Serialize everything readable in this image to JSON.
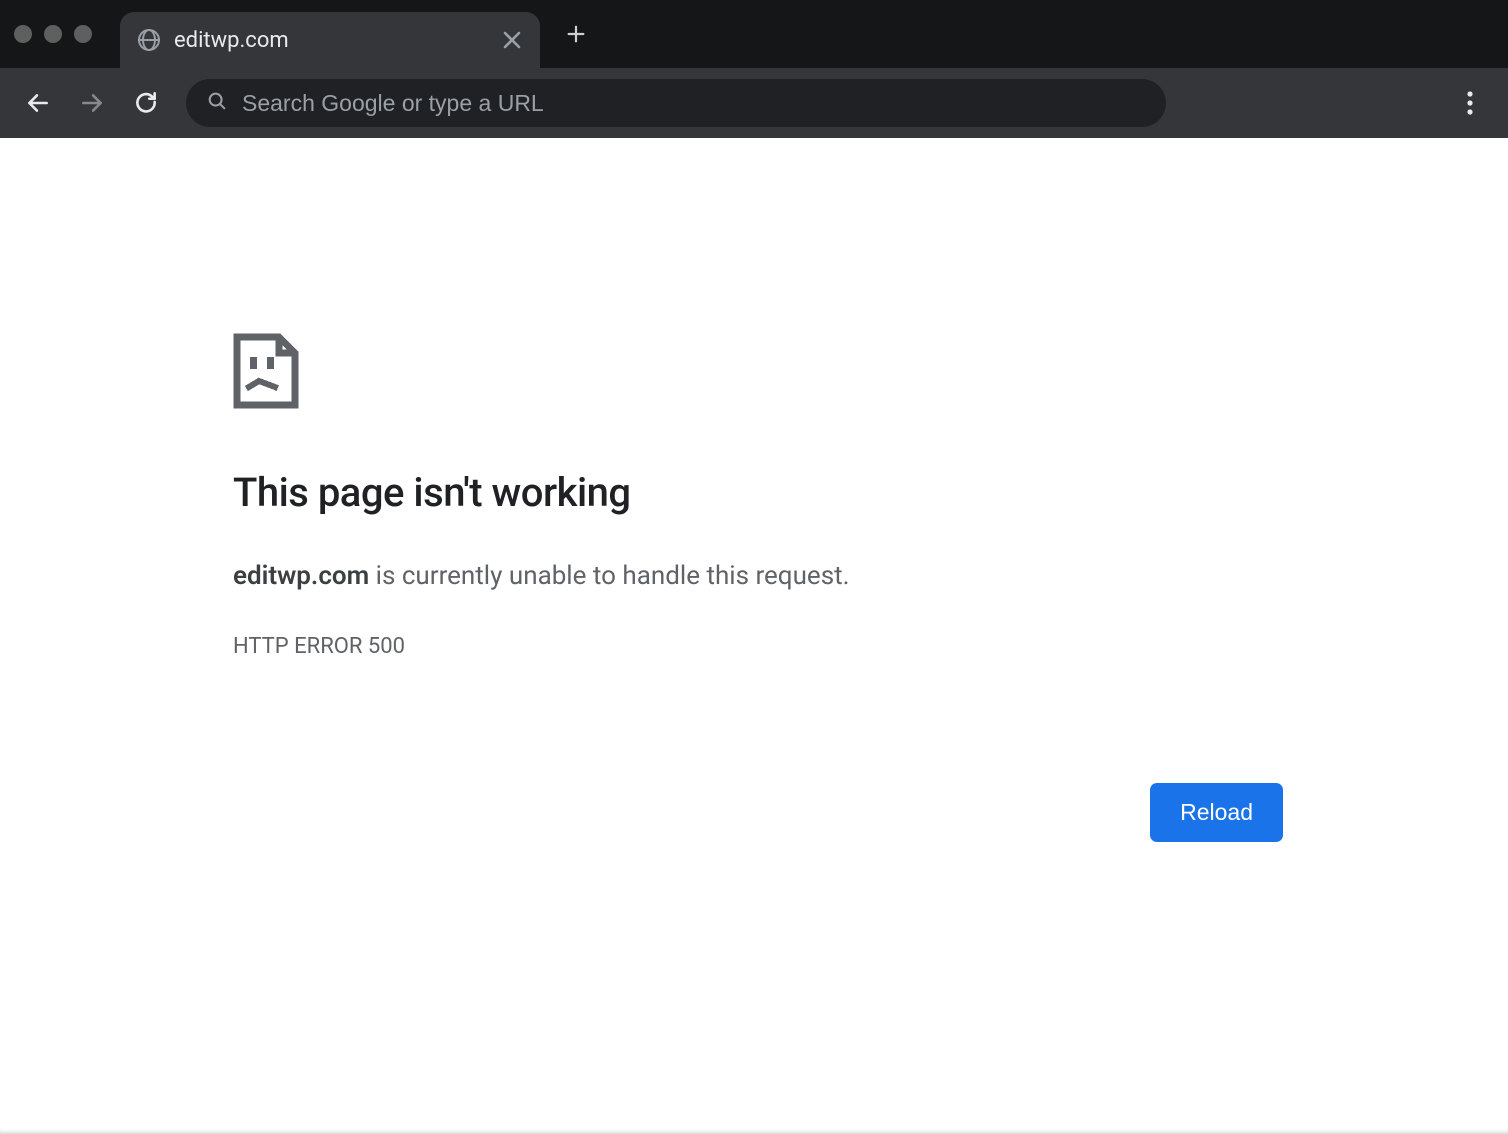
{
  "tab": {
    "title": "editwp.com"
  },
  "omnibox": {
    "placeholder": "Search Google or type a URL"
  },
  "error": {
    "heading": "This page isn't working",
    "domain": "editwp.com",
    "message_suffix": " is currently unable to handle this request.",
    "code": "HTTP ERROR 500",
    "reload_label": "Reload"
  }
}
